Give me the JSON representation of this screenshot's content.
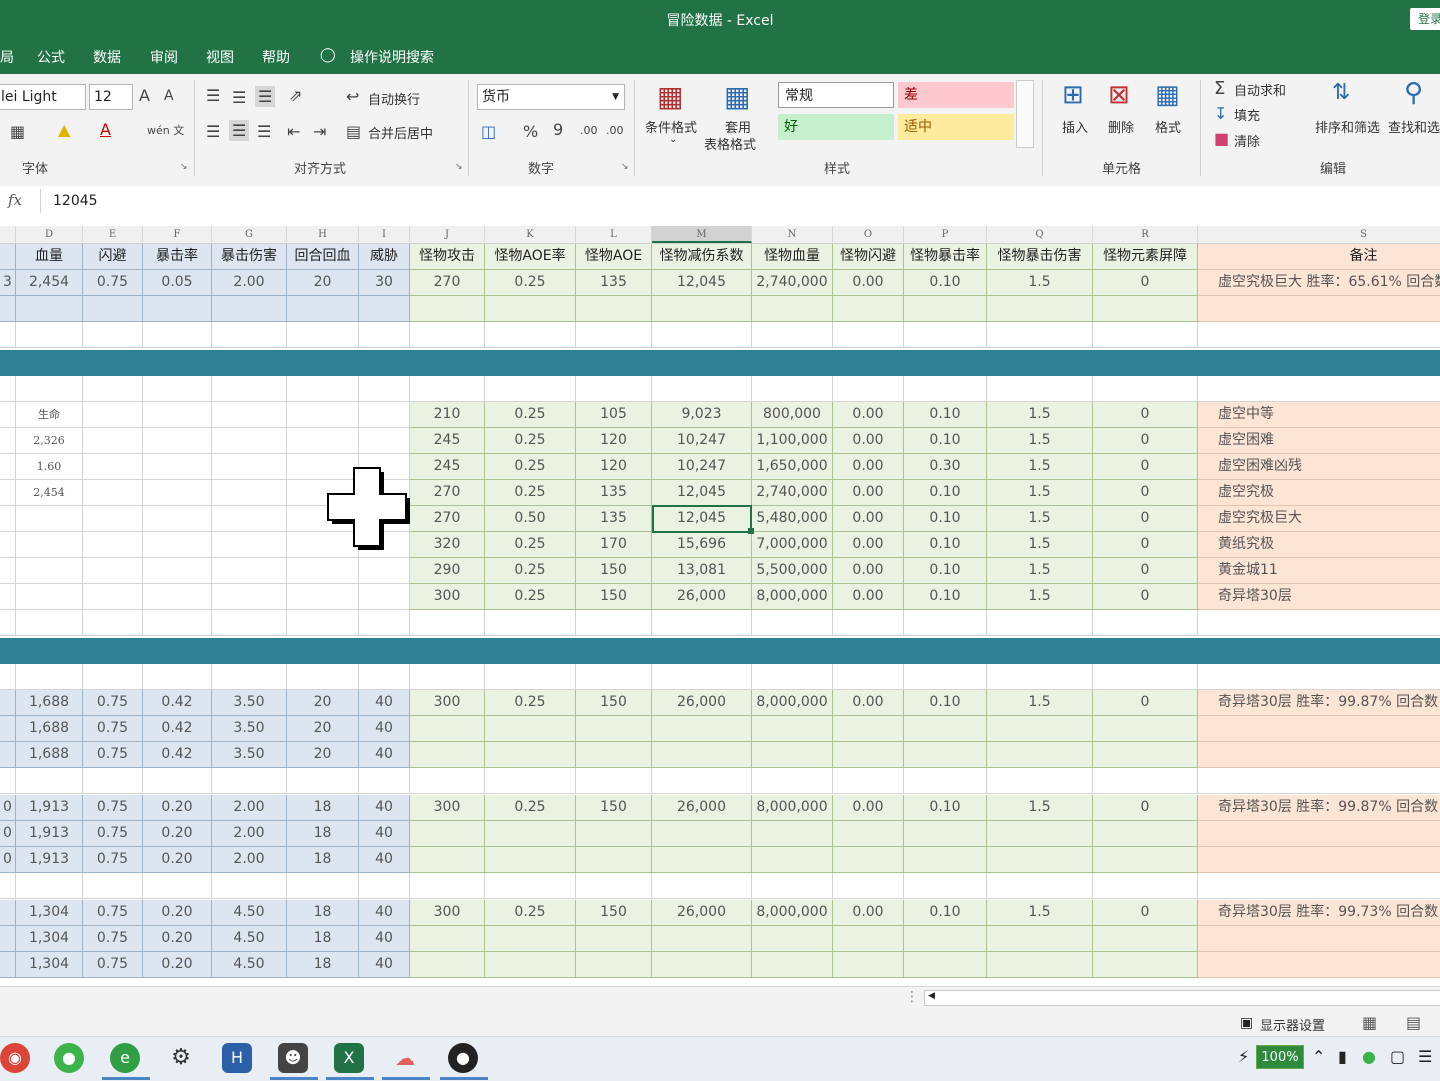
{
  "window": {
    "title": "冒险数据  -  Excel",
    "login_label": "登录"
  },
  "menu": [
    {
      "id": "layout",
      "label": "局"
    },
    {
      "id": "formula",
      "label": "公式"
    },
    {
      "id": "data",
      "label": "数据"
    },
    {
      "id": "review",
      "label": "审阅"
    },
    {
      "id": "view",
      "label": "视图"
    },
    {
      "id": "help",
      "label": "帮助"
    },
    {
      "id": "tellme",
      "label": "操作说明搜索"
    }
  ],
  "ribbon": {
    "font": {
      "name": "lei Light",
      "size": "12",
      "group_label": "字体",
      "grow": "A",
      "shrink": "A",
      "phonetic": "wén 文"
    },
    "align": {
      "wrap": "自动换行",
      "merge": "合并后居中",
      "group_label": "对齐方式"
    },
    "number": {
      "format": "货币",
      "percent": "%",
      "comma": "9",
      "inc": ".00",
      "dec": ".00",
      "group_label": "数字"
    },
    "styles": {
      "cond_format": "条件格式",
      "table_format_1": "套用",
      "table_format_2": "表格格式",
      "normal": "常规",
      "bad": "差",
      "good": "好",
      "neutral": "适中",
      "group_label": "样式"
    },
    "cells": {
      "insert": "插入",
      "delete": "删除",
      "format": "格式",
      "group_label": "单元格"
    },
    "editing": {
      "autosum": "自动求和",
      "fill": "填充",
      "clear": "清除",
      "sort": "排序和筛选",
      "find": "查找和选",
      "group_label": "编辑"
    }
  },
  "formula_bar": {
    "fx": "fx",
    "value": "12045"
  },
  "columns": [
    "",
    "D",
    "E",
    "F",
    "G",
    "H",
    "I",
    "J",
    "K",
    "L",
    "M",
    "N",
    "O",
    "P",
    "Q",
    "R",
    "S"
  ],
  "selected_column": "M",
  "header_row": [
    "",
    "血量",
    "闪避",
    "暴击率",
    "暴击伤害",
    "回合回血",
    "威胁",
    "怪物攻击",
    "怪物AOE率",
    "怪物AOE",
    "怪物减伤系数",
    "怪物血量",
    "怪物闪避",
    "怪物暴击率",
    "怪物暴击伤害",
    "怪物元素屏障",
    "备注"
  ],
  "top_row": [
    "3",
    "2,454",
    "0.75",
    "0.05",
    "2.00",
    "20",
    "30",
    "270",
    "0.25",
    "135",
    "12,045",
    "2,740,000",
    "0.00",
    "0.10",
    "1.5",
    "0",
    "虚空究极巨大 胜率：65.61% 回合数"
  ],
  "mid_left": [
    {
      "d": "生命"
    },
    {
      "d": "2,326"
    },
    {
      "d": "1.60"
    },
    {
      "d": "2,454"
    }
  ],
  "monster_rows": [
    [
      "210",
      "0.25",
      "105",
      "9,023",
      "800,000",
      "0.00",
      "0.10",
      "1.5",
      "0",
      "虚空中等"
    ],
    [
      "245",
      "0.25",
      "120",
      "10,247",
      "1,100,000",
      "0.00",
      "0.10",
      "1.5",
      "0",
      "虚空困难"
    ],
    [
      "245",
      "0.25",
      "120",
      "10,247",
      "1,650,000",
      "0.00",
      "0.30",
      "1.5",
      "0",
      "虚空困难凶残"
    ],
    [
      "270",
      "0.25",
      "135",
      "12,045",
      "2,740,000",
      "0.00",
      "0.10",
      "1.5",
      "0",
      "虚空究极"
    ],
    [
      "270",
      "0.50",
      "135",
      "12,045",
      "5,480,000",
      "0.00",
      "0.10",
      "1.5",
      "0",
      "虚空究极巨大"
    ],
    [
      "320",
      "0.25",
      "170",
      "15,696",
      "7,000,000",
      "0.00",
      "0.10",
      "1.5",
      "0",
      "黄纸究极"
    ],
    [
      "290",
      "0.25",
      "150",
      "13,081",
      "5,500,000",
      "0.00",
      "0.10",
      "1.5",
      "0",
      "黄金城11"
    ],
    [
      "300",
      "0.25",
      "150",
      "26,000",
      "8,000,000",
      "0.00",
      "0.10",
      "1.5",
      "0",
      "奇异塔30层"
    ]
  ],
  "blocks": [
    {
      "rows": [
        [
          "",
          "1,688",
          "0.75",
          "0.42",
          "3.50",
          "20",
          "40"
        ],
        [
          "",
          "1,688",
          "0.75",
          "0.42",
          "3.50",
          "20",
          "40"
        ],
        [
          "",
          "1,688",
          "0.75",
          "0.42",
          "3.50",
          "20",
          "40"
        ]
      ],
      "monster": [
        "300",
        "0.25",
        "150",
        "26,000",
        "8,000,000",
        "0.00",
        "0.10",
        "1.5",
        "0"
      ],
      "note": "奇异塔30层 胜率：99.87% 回合数："
    },
    {
      "rows": [
        [
          "0",
          "1,913",
          "0.75",
          "0.20",
          "2.00",
          "18",
          "40"
        ],
        [
          "0",
          "1,913",
          "0.75",
          "0.20",
          "2.00",
          "18",
          "40"
        ],
        [
          "0",
          "1,913",
          "0.75",
          "0.20",
          "2.00",
          "18",
          "40"
        ]
      ],
      "monster": [
        "300",
        "0.25",
        "150",
        "26,000",
        "8,000,000",
        "0.00",
        "0.10",
        "1.5",
        "0"
      ],
      "note": "奇异塔30层 胜率：99.87% 回合数："
    },
    {
      "rows": [
        [
          "",
          "1,304",
          "0.75",
          "0.20",
          "4.50",
          "18",
          "40"
        ],
        [
          "",
          "1,304",
          "0.75",
          "0.20",
          "4.50",
          "18",
          "40"
        ],
        [
          "",
          "1,304",
          "0.75",
          "0.20",
          "4.50",
          "18",
          "40"
        ]
      ],
      "monster": [
        "300",
        "0.25",
        "150",
        "26,000",
        "8,000,000",
        "0.00",
        "0.10",
        "1.5",
        "0"
      ],
      "note": "奇异塔30层 胜率：99.73% 回合数："
    }
  ],
  "status": {
    "display_settings": "显示器设置"
  },
  "taskbar": {
    "battery": "100%"
  },
  "colors": {
    "excel_green": "#217346",
    "band": "#2f8196",
    "blue_fill": "#dde6f0",
    "green_fill": "#eaf2e1",
    "orange_fill": "#fde5d6"
  }
}
